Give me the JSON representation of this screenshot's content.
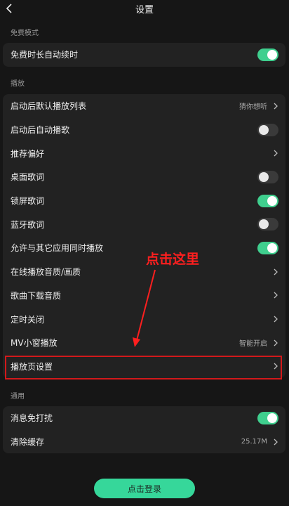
{
  "header": {
    "title": "设置"
  },
  "sections": {
    "free": {
      "label": "免费模式",
      "rows": [
        {
          "label": "免费时长自动续时",
          "toggle": "on"
        }
      ]
    },
    "play": {
      "label": "播放",
      "rows": [
        {
          "label": "启动后默认播放列表",
          "value": "猜你想听"
        },
        {
          "label": "启动后自动播歌",
          "toggle": "off"
        },
        {
          "label": "推荐偏好"
        },
        {
          "label": "桌面歌词",
          "toggle": "off"
        },
        {
          "label": "锁屏歌词",
          "toggle": "on"
        },
        {
          "label": "蓝牙歌词",
          "toggle": "off"
        },
        {
          "label": "允许与其它应用同时播放",
          "toggle": "on"
        },
        {
          "label": "在线播放音质/画质"
        },
        {
          "label": "歌曲下载音质"
        },
        {
          "label": "定时关闭"
        },
        {
          "label": "MV小窗播放",
          "value": "智能开启"
        },
        {
          "label": "播放页设置"
        }
      ]
    },
    "general": {
      "label": "通用",
      "rows": [
        {
          "label": "消息免打扰",
          "toggle": "on"
        },
        {
          "label": "清除缓存",
          "value": "25.17M"
        }
      ]
    }
  },
  "annotation": {
    "text": "点击这里"
  },
  "login": {
    "label": "点击登录"
  },
  "colors": {
    "accent": "#3fcf8e",
    "annotation": "#d2191b",
    "background": "#161616",
    "card": "#222222"
  },
  "icons": {
    "back": "chevron-left-icon",
    "row_arrow": "chevron-right-icon"
  }
}
